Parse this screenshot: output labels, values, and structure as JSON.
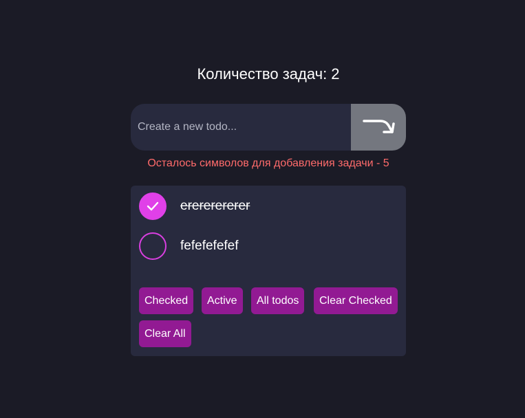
{
  "header": {
    "count_label": "Количество задач: 2"
  },
  "input": {
    "placeholder": "Create a new todo...",
    "value": ""
  },
  "submit_icon": "enter-arrow-icon",
  "warning_text": "Осталось символов для добавления задачи - 5",
  "todos": [
    {
      "text": "erererererer",
      "checked": true
    },
    {
      "text": "fefefefefef",
      "checked": false
    }
  ],
  "filters": {
    "checked_label": "Checked",
    "active_label": "Active",
    "all_label": "All todos",
    "clear_checked_label": "Clear Checked",
    "clear_all_label": "Clear All"
  },
  "colors": {
    "background": "#1b1b26",
    "panel": "#282a3e",
    "accent": "#e040e8",
    "button": "#921a93",
    "submit": "#74777f",
    "warning": "#ff6b6b"
  }
}
